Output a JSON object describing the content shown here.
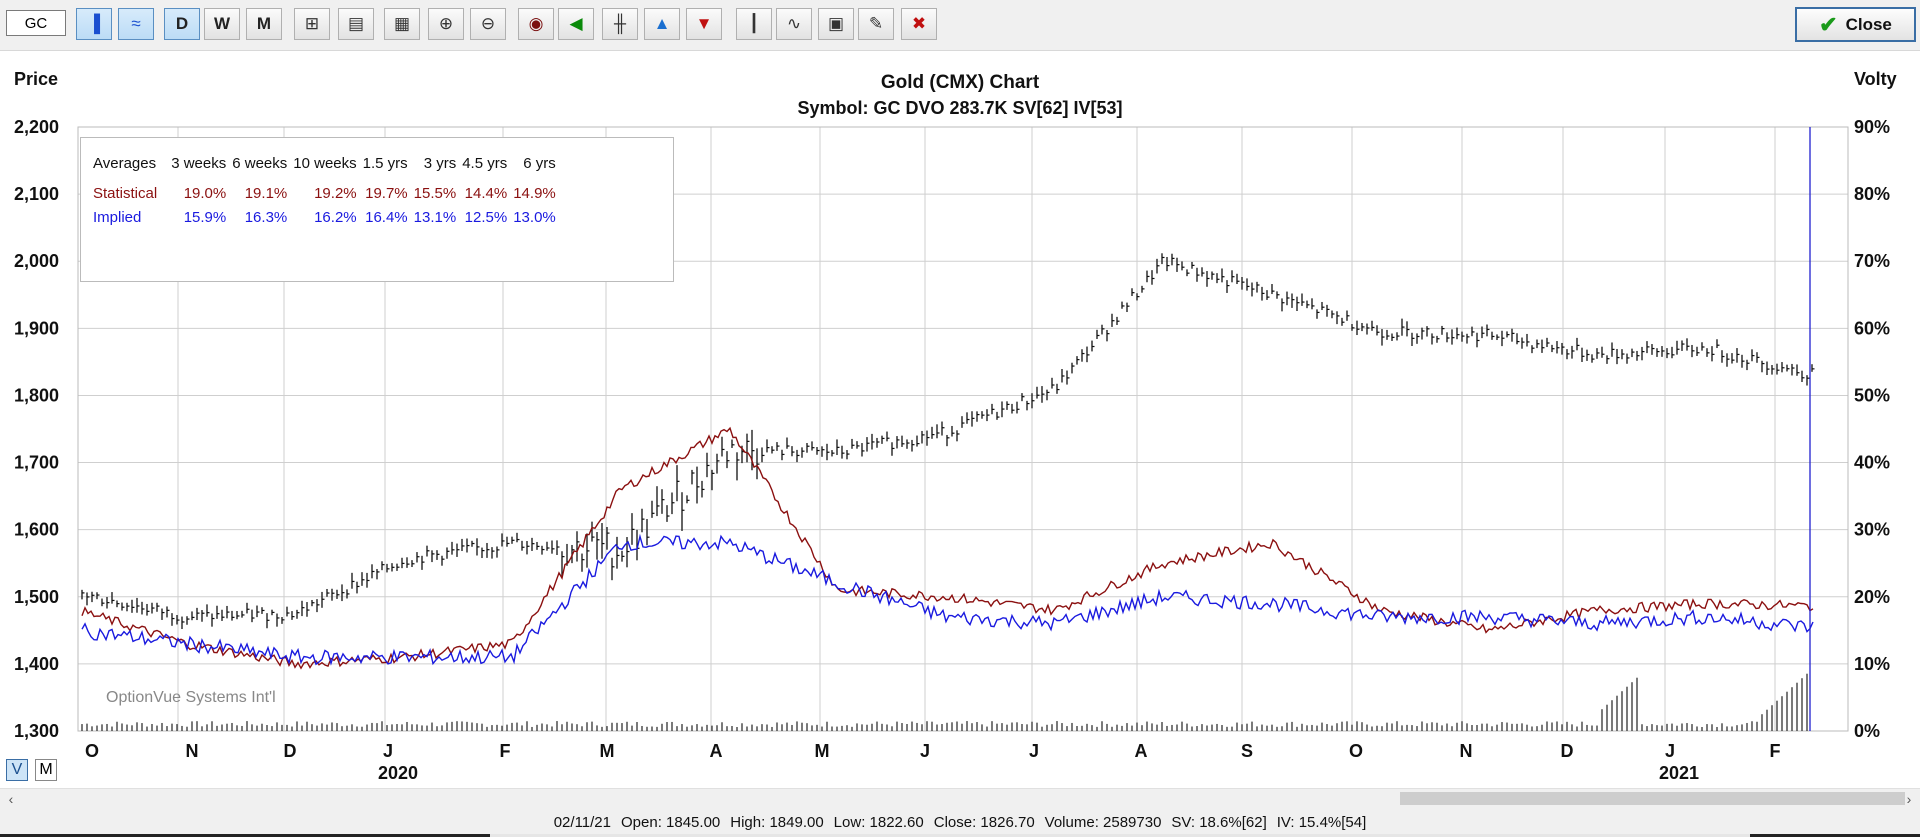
{
  "toolbar": {
    "symbol_value": "GC",
    "buttons": [
      {
        "name": "candle-view-button",
        "icon": "bar-chart-icon",
        "active": true
      },
      {
        "name": "line-view-button",
        "icon": "line-chart-icon",
        "active": true
      },
      {
        "name": "daily-button",
        "label": "D",
        "active": true
      },
      {
        "name": "weekly-button",
        "label": "W",
        "active": false
      },
      {
        "name": "monthly-button",
        "label": "M",
        "active": false
      },
      {
        "name": "scale-button",
        "icon": "scale-icon"
      },
      {
        "name": "copy-button",
        "icon": "clipboard-icon"
      },
      {
        "name": "calendar-button",
        "icon": "calendar-icon"
      },
      {
        "name": "zoom-in-button",
        "icon": "zoom-in-icon"
      },
      {
        "name": "zoom-out-button",
        "icon": "zoom-out-icon"
      },
      {
        "name": "target-button",
        "icon": "target-icon"
      },
      {
        "name": "trend-button",
        "icon": "trend-icon"
      },
      {
        "name": "hilo-button",
        "icon": "hilo-icon"
      },
      {
        "name": "up-triangle-button",
        "icon": "up-triangle-icon"
      },
      {
        "name": "down-triangle-button",
        "icon": "down-triangle-icon"
      },
      {
        "name": "bar-pattern-button",
        "icon": "bar-pattern-icon"
      },
      {
        "name": "study-button",
        "icon": "study-icon"
      },
      {
        "name": "print-button",
        "icon": "print-icon"
      },
      {
        "name": "pencil-button",
        "icon": "pencil-icon"
      },
      {
        "name": "delete-button",
        "icon": "delete-icon"
      }
    ],
    "close_label": "Close"
  },
  "chart_panel": {
    "left_label": "Price",
    "right_label": "Volty",
    "watermark": "OptionVue Systems Int'l"
  },
  "view_toggle": {
    "v_label": "V",
    "m_label": "M"
  },
  "averages_table": {
    "headers": [
      "Averages",
      "3 weeks",
      "6 weeks",
      "10 weeks",
      "1.5 yrs",
      "3 yrs",
      "4.5 yrs",
      "6 yrs"
    ],
    "statistical": {
      "label": "Statistical",
      "values": [
        "19.0%",
        "19.1%",
        "19.2%",
        "19.7%",
        "15.5%",
        "14.4%",
        "14.9%"
      ]
    },
    "implied": {
      "label": "Implied",
      "values": [
        "15.9%",
        "16.3%",
        "16.2%",
        "16.4%",
        "13.1%",
        "12.5%",
        "13.0%"
      ]
    }
  },
  "status_bar": {
    "date": "02/11/21",
    "open": "Open: 1845.00",
    "high": "High: 1849.00",
    "low": "Low: 1822.60",
    "close": "Close: 1826.70",
    "volume": "Volume: 2589730",
    "sv": "SV: 18.6%[62]",
    "iv": "IV: 15.4%[54]"
  },
  "colors": {
    "price_bars": "#111111",
    "statistical_vol": "#8b1010",
    "implied_vol": "#1a1adf",
    "cursor_line": "#2020d0",
    "grid": "#cfcfcf"
  },
  "chart_data": {
    "type": "line",
    "title": "Gold (CMX) Chart",
    "subtitle": "Symbol: GC  DVO 283.7K  SV[62]  IV[53]",
    "ylabel": "Price",
    "ylabel_right": "Volty",
    "ylim": [
      1300,
      2200
    ],
    "ylim_right": [
      0,
      90
    ],
    "y_ticks": [
      "2,200",
      "2,100",
      "2,000",
      "1,900",
      "1,800",
      "1,700",
      "1,600",
      "1,500",
      "1,400",
      "1,300"
    ],
    "y_ticks_right": [
      "90%",
      "80%",
      "70%",
      "60%",
      "50%",
      "40%",
      "30%",
      "20%",
      "10%",
      "0%"
    ],
    "x_month_labels": [
      "O",
      "N",
      "D",
      "J",
      "F",
      "M",
      "A",
      "M",
      "J",
      "J",
      "A",
      "S",
      "O",
      "N",
      "D",
      "J",
      "F"
    ],
    "x_year_labels": [
      "2020",
      "2021"
    ],
    "grid": true,
    "x": [
      "2019-10",
      "2019-11",
      "2019-12",
      "2020-01",
      "2020-02",
      "2020-03",
      "2020-04",
      "2020-05",
      "2020-06",
      "2020-07",
      "2020-08",
      "2020-09",
      "2020-10",
      "2020-11",
      "2020-12",
      "2021-01",
      "2021-02"
    ],
    "series": [
      {
        "name": "Price",
        "axis": "left",
        "style": "hlc-bars",
        "values": [
          1505,
          1470,
          1475,
          1555,
          1580,
          1570,
          1720,
          1715,
          1745,
          1810,
          2000,
          1950,
          1895,
          1890,
          1860,
          1870,
          1830
        ]
      },
      {
        "name": "Statistical",
        "axis": "right",
        "values": [
          18,
          13,
          10,
          11,
          13,
          36,
          45,
          21,
          20,
          18,
          25,
          28,
          18,
          15,
          18,
          19,
          18.6
        ]
      },
      {
        "name": "Implied",
        "axis": "right",
        "values": [
          15,
          13,
          11,
          11,
          11,
          28,
          28,
          22,
          17,
          16,
          20,
          19,
          17,
          17,
          16,
          17,
          15.4
        ]
      }
    ]
  }
}
